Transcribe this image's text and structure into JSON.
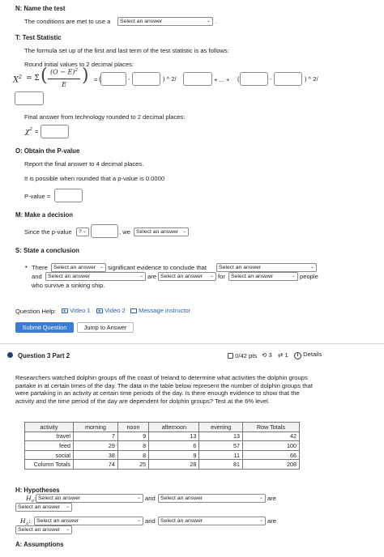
{
  "step_n": {
    "heading": "N: Name the test",
    "sentence_start": "The conditions are met to use a",
    "select_value": "Select an answer",
    "sentence_end": "."
  },
  "step_t": {
    "heading": "T: Test Statistic",
    "formula_instruction": "The formula set up of the first and last term of the test statistic is as follows:",
    "round_instruction": "Round initial values to 2 decimal places:",
    "chi_label": "X",
    "chi_exp": "2",
    "equals_sigma": "= Σ",
    "frac_numerator": "(O − E)",
    "frac_exp": "2",
    "frac_denominator": "E",
    "eq_sign": "=",
    "paren_open": "(",
    "minus": "-",
    "power_div_1": ") ^ 2/",
    "plus_dots": "+ ... +",
    "power_div_2": ") ^ 2/",
    "final_instruction": "Final answer from technology rounded to 2 decimal places:",
    "chi_final": "χ",
    "chi_final_exp": "2",
    "chi_final_eq": "="
  },
  "step_o": {
    "heading": "O: Obtain the P-value",
    "report_text": "Report the final answer to 4 decimal places.",
    "possible_text": "It is possible when rounded that a p-value is 0.0000",
    "pvalue_label": "P-value ="
  },
  "step_m": {
    "heading": "M: Make a decision",
    "since_text": "Since the p-value",
    "compare_value": "?",
    "we_text": ", we",
    "decision_value": "Select an answer"
  },
  "step_s": {
    "heading": "S: State a conclusion",
    "bullet": "•",
    "there_text": "There",
    "evidence_select": "Select an answer",
    "significant_text": "significant evidence to conclude that",
    "conclusion_select": "Select an answer",
    "and_text": "and",
    "and_select": "Select an answer",
    "are_text": "are",
    "are_select": "Select an answer",
    "for_text": "for",
    "for_select": "Select an answer",
    "people_text": "people",
    "survivors_text": "who survive a sinking ship."
  },
  "help": {
    "label": "Question Help:",
    "video1": "Video 1",
    "video2": "Video 2",
    "message": "Message instructor"
  },
  "buttons": {
    "submit": "Submit Question",
    "jump": "Jump to Answer"
  },
  "part2": {
    "title": "Question 3 Part 2",
    "points": "0/42 pts",
    "retries": "3",
    "attempts": "1",
    "details": "Details",
    "problem_text": "Researchers watched dolphin groups off the coast of Ireland to determine what activities the dolphin groups partake in at certain times of the day. The data in the table below represent the number of dolphin groups that were partaking in an activity at certain time periods of the day. Is there enough evidence to show that the activity and the time period of the day are dependent for dolphin groups? Test at the 6% level."
  },
  "table": {
    "headers": [
      "activity",
      "morning",
      "noon",
      "afternoon",
      "evening",
      "Row Totals"
    ],
    "rows": [
      [
        "travel",
        "7",
        "9",
        "13",
        "13",
        "42"
      ],
      [
        "feed",
        "29",
        "8",
        "6",
        "57",
        "100"
      ],
      [
        "social",
        "38",
        "8",
        "9",
        "11",
        "66"
      ],
      [
        "Column Totals",
        "74",
        "25",
        "28",
        "81",
        "208"
      ]
    ]
  },
  "hypotheses": {
    "heading": "H: Hypotheses",
    "h0_label": "H",
    "h0_sub": "0",
    "h1_label": "H",
    "h1_sub": "A",
    "colon": ":",
    "select": "Select an answer",
    "and_text": "and",
    "are_text": "are"
  },
  "assumptions": {
    "heading": "A: Assumptions"
  },
  "colors": {
    "link": "#2d5fb8",
    "primary_button": "#3b7ad5"
  }
}
